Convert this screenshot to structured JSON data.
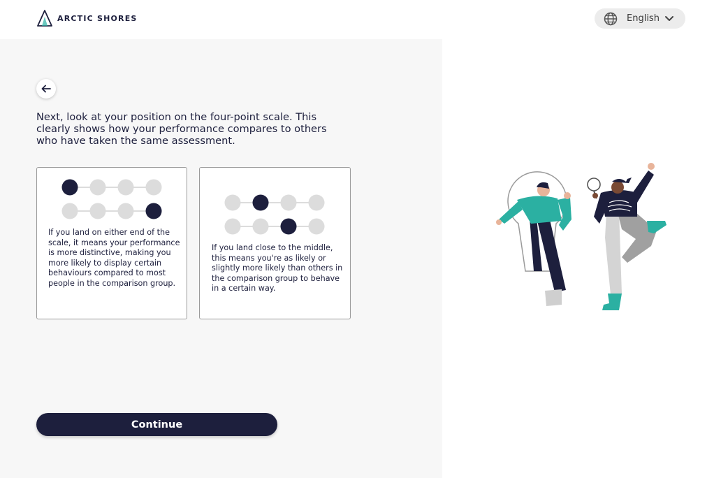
{
  "header": {
    "brand": "ARCTIC SHORES",
    "language": {
      "label": "English",
      "icon": "globe-icon",
      "chevron": "chevron-down-icon"
    }
  },
  "main": {
    "back_icon": "arrow-left-icon",
    "intro": "Next, look at your position on the four-point scale. This clearly shows how your performance compares to others who have taken the same assessment.",
    "cards": [
      {
        "text": "If you land on either end of the scale, it means your performance is more distinctive, making you more likely to display certain behaviours compared to most people in the comparison group.",
        "scales": [
          [
            1,
            0,
            0,
            0
          ],
          [
            0,
            0,
            0,
            1
          ]
        ]
      },
      {
        "text": "If you land close to the middle, this means you're as likely or slightly more likely than others in the comparison group to behave in a certain way.",
        "scales": [
          [
            0,
            1,
            0,
            0
          ],
          [
            0,
            0,
            1,
            0
          ]
        ]
      }
    ],
    "continue_label": "Continue"
  },
  "colors": {
    "navy": "#1d1f3d",
    "dot_inactive": "#dcdcdc",
    "panel_bg": "#f7f7f7",
    "teal": "#2bb0a2"
  }
}
